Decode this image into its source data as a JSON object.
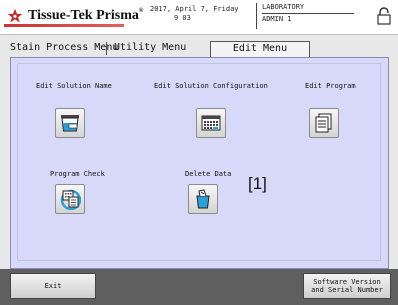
{
  "header": {
    "brand": "Tissue-Tek Prisma",
    "brand_mark": "®",
    "date": "2017, April 7, Friday",
    "time": "9 03",
    "lab": "LABORATORY",
    "user": "ADMIN 1"
  },
  "tabs": [
    {
      "label": "Stain Process Menu",
      "active": false
    },
    {
      "label": "Utility Menu",
      "active": false
    },
    {
      "label": "Edit Menu",
      "active": true
    }
  ],
  "menu": {
    "edit_solution_name": "Edit Solution Name",
    "edit_solution_configuration": "Edit Solution Configuration",
    "edit_program": "Edit Program",
    "program_check": "Program Check",
    "delete_data": "Delete Data"
  },
  "annotation": "[1]",
  "bottom": {
    "exit": "Exit",
    "version": "Software Version\nand Serial Number"
  },
  "colors": {
    "panel_bg": "#d8d8f8",
    "bottom_bar": "#5f5f5f",
    "brand_red": "#cc3333",
    "icon_blue": "#2a9fd8"
  }
}
